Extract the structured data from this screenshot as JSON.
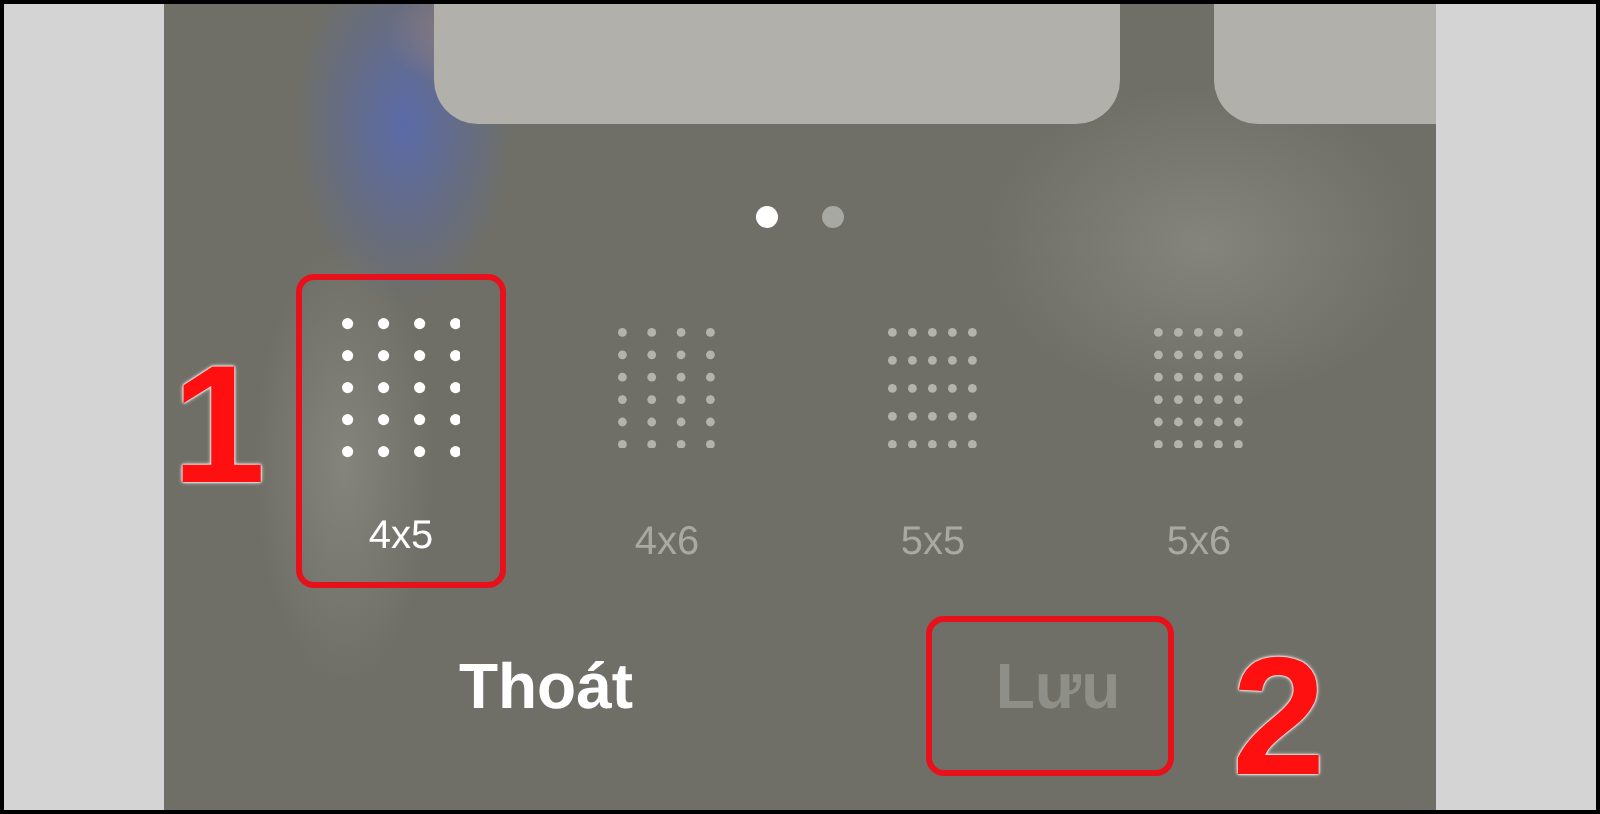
{
  "pager": {
    "dots": [
      {
        "selected": true
      },
      {
        "selected": false
      }
    ]
  },
  "grid_options": [
    {
      "label": "4x5",
      "selected": true
    },
    {
      "label": "4x6",
      "selected": false
    },
    {
      "label": "5x5",
      "selected": false
    },
    {
      "label": "5x6",
      "selected": false
    }
  ],
  "buttons": [
    {
      "label": "Thoát",
      "disabled": false
    },
    {
      "label": "Lưu",
      "disabled": true
    }
  ],
  "annotations": [
    {
      "kind": "option",
      "label": "1"
    },
    {
      "kind": "button",
      "label": "2"
    }
  ]
}
